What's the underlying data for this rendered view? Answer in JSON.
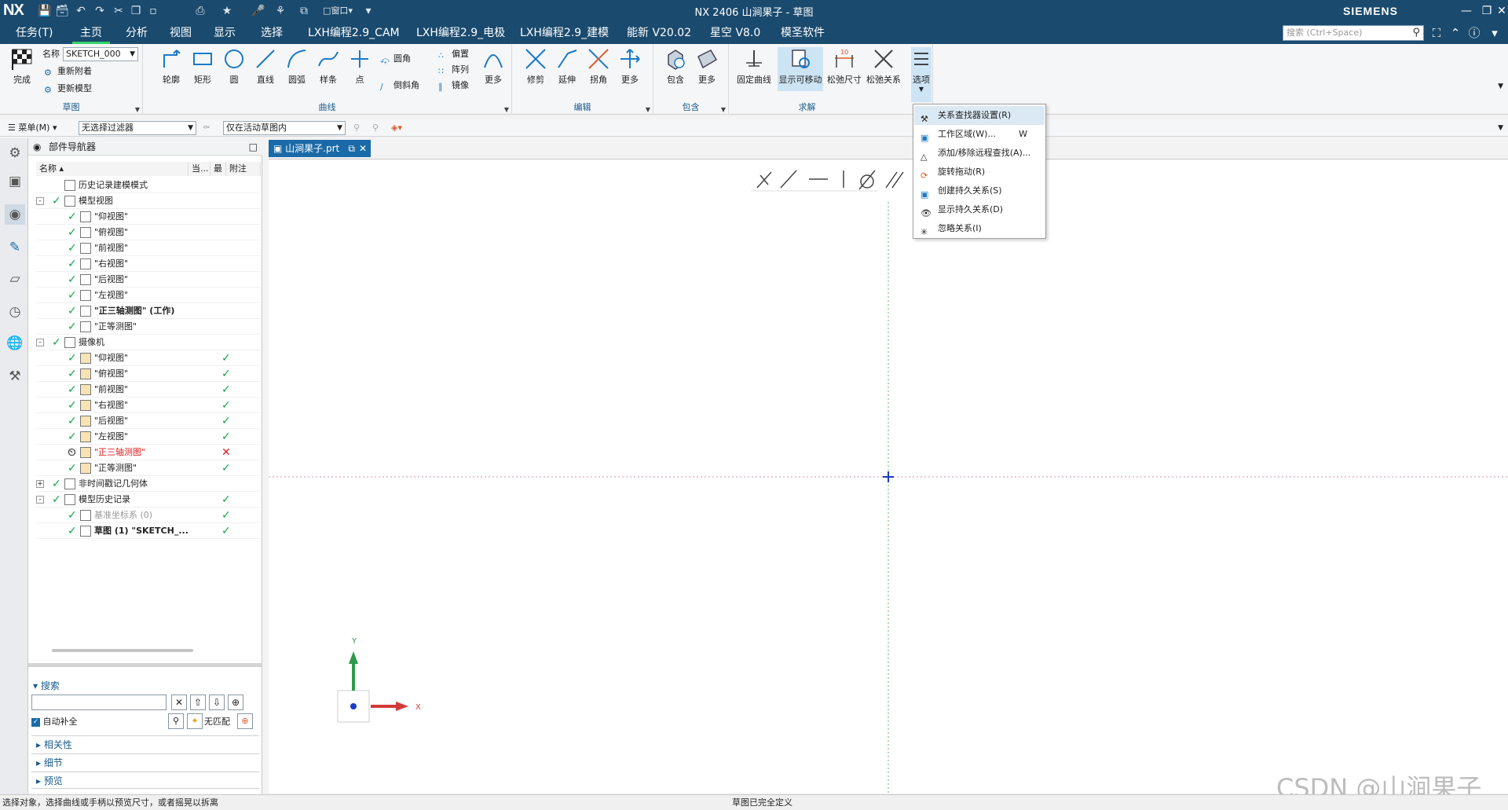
{
  "app": {
    "logo": "NX",
    "title": "NX 2406 山涧果子 - 草图",
    "brand": "SIEMENS",
    "window_menu_label": "窗口"
  },
  "menu_tabs": [
    {
      "label": "任务(T)"
    },
    {
      "label": "主页"
    },
    {
      "label": "分析"
    },
    {
      "label": "视图"
    },
    {
      "label": "显示"
    },
    {
      "label": "选择"
    },
    {
      "label": "LXH编程2.9_CAM"
    },
    {
      "label": "LXH编程2.9_电极"
    },
    {
      "label": "LXH编程2.9_建模"
    },
    {
      "label": "能新 V20.02"
    },
    {
      "label": "星空 V8.0"
    },
    {
      "label": "模圣软件"
    }
  ],
  "command_search": {
    "placeholder": "搜索 (Ctrl+Space)"
  },
  "ribbon": {
    "sketch_group": {
      "label": "草图",
      "finish_label": "完成",
      "name_label": "名称",
      "name_value": "SKETCH_000",
      "reattach_label": "重新附着",
      "update_model_label": "更新模型"
    },
    "curve_group": {
      "label": "曲线",
      "buttons": [
        "轮廓",
        "矩形",
        "圆",
        "直线",
        "圆弧",
        "样条",
        "点"
      ],
      "fillet_label": "圆角",
      "chamfer_label": "倒斜角",
      "offset_label": "偏置",
      "pattern_label": "阵列",
      "mirror_label": "镜像",
      "more_label": "更多"
    },
    "edit_group": {
      "label": "编辑",
      "buttons": [
        "修剪",
        "延伸",
        "拐角",
        "更多"
      ]
    },
    "include_group": {
      "label": "包含",
      "buttons": [
        "包含",
        "更多"
      ]
    },
    "solve_group": {
      "label": "求解",
      "buttons": [
        "固定曲线",
        "显示可移动",
        "松弛尺寸",
        "松弛关系",
        "选项"
      ]
    }
  },
  "filter_bar": {
    "menu_label": "菜单(M)",
    "filter_value": "无选择过滤器",
    "scope_value": "仅在活动草图内"
  },
  "navigator": {
    "title": "部件导航器",
    "columns": [
      "名称",
      "当...",
      "最",
      "附注"
    ],
    "rows": [
      {
        "label": "历史记录建模模式",
        "indent": 1,
        "bold": false
      },
      {
        "label": "模型视图",
        "indent": 1,
        "bold": false,
        "toggle": "-"
      },
      {
        "label": "\"仰视图\"",
        "indent": 2,
        "bold": false
      },
      {
        "label": "\"俯视图\"",
        "indent": 2,
        "bold": false
      },
      {
        "label": "\"前视图\"",
        "indent": 2,
        "bold": false
      },
      {
        "label": "\"右视图\"",
        "indent": 2,
        "bold": false
      },
      {
        "label": "\"后视图\"",
        "indent": 2,
        "bold": false
      },
      {
        "label": "\"左视图\"",
        "indent": 2,
        "bold": false
      },
      {
        "label": "\"正三轴测图\" (工作)",
        "indent": 2,
        "bold": true
      },
      {
        "label": "\"正等测图\"",
        "indent": 2,
        "bold": false
      },
      {
        "label": "摄像机",
        "indent": 1,
        "bold": false,
        "toggle": "-"
      },
      {
        "label": "\"仰视图\"",
        "indent": 2,
        "bold": false,
        "latest": "check"
      },
      {
        "label": "\"俯视图\"",
        "indent": 2,
        "bold": false,
        "latest": "check"
      },
      {
        "label": "\"前视图\"",
        "indent": 2,
        "bold": false,
        "latest": "check"
      },
      {
        "label": "\"右视图\"",
        "indent": 2,
        "bold": false,
        "latest": "check"
      },
      {
        "label": "\"后视图\"",
        "indent": 2,
        "bold": false,
        "latest": "check"
      },
      {
        "label": "\"左视图\"",
        "indent": 2,
        "bold": false,
        "latest": "check"
      },
      {
        "label": "\"正三轴测图\"",
        "indent": 2,
        "bold": false,
        "latest": "cross",
        "red": true
      },
      {
        "label": "\"正等测图\"",
        "indent": 2,
        "bold": false,
        "latest": "check"
      },
      {
        "label": "非时间戳记几何体",
        "indent": 1,
        "bold": false,
        "toggle": "+"
      },
      {
        "label": "模型历史记录",
        "indent": 1,
        "bold": false,
        "toggle": "-",
        "latest": "check"
      },
      {
        "label": "基准坐标系 (0)",
        "indent": 2,
        "bold": false,
        "latest": "check",
        "grey": true
      },
      {
        "label": "草图 (1) \"SKETCH_...",
        "indent": 2,
        "bold": true,
        "latest": "check"
      }
    ],
    "search": {
      "title": "搜索",
      "auto_complete_label": "自动补全",
      "no_match_label": "无匹配"
    },
    "sections": [
      "相关性",
      "细节",
      "预览"
    ]
  },
  "document_tab": {
    "label": "山涧果子.prt"
  },
  "options_menu": {
    "items": [
      {
        "label": "关系查找器设置(R)",
        "shortcut": "",
        "highlighted": true
      },
      {
        "label": "工作区域(W)...",
        "shortcut": "W",
        "highlighted": false
      },
      {
        "label": "添加/移除远程查找(A)...",
        "shortcut": "",
        "highlighted": false
      },
      {
        "label": "旋转拖动(R)",
        "shortcut": "",
        "highlighted": false
      },
      {
        "label": "创建持久关系(S)",
        "shortcut": "",
        "highlighted": false
      },
      {
        "label": "显示持久关系(D)",
        "shortcut": "",
        "highlighted": false
      },
      {
        "label": "忽略关系(I)",
        "shortcut": "",
        "highlighted": false
      }
    ]
  },
  "axis_triad": {
    "x_label": "X",
    "y_label": "Y"
  },
  "status": {
    "left": "选择对象，选择曲线或手柄以预览尺寸，或者摇晃以拆离",
    "center": "草图已完全定义"
  },
  "watermark": "CSDN @山涧果子",
  "colors": {
    "title_bar": "#1a4a6e",
    "accent_green": "#34d36b",
    "check_green": "#18a34a",
    "error_red": "#e02020",
    "tab_blue": "#1a6aa8"
  }
}
